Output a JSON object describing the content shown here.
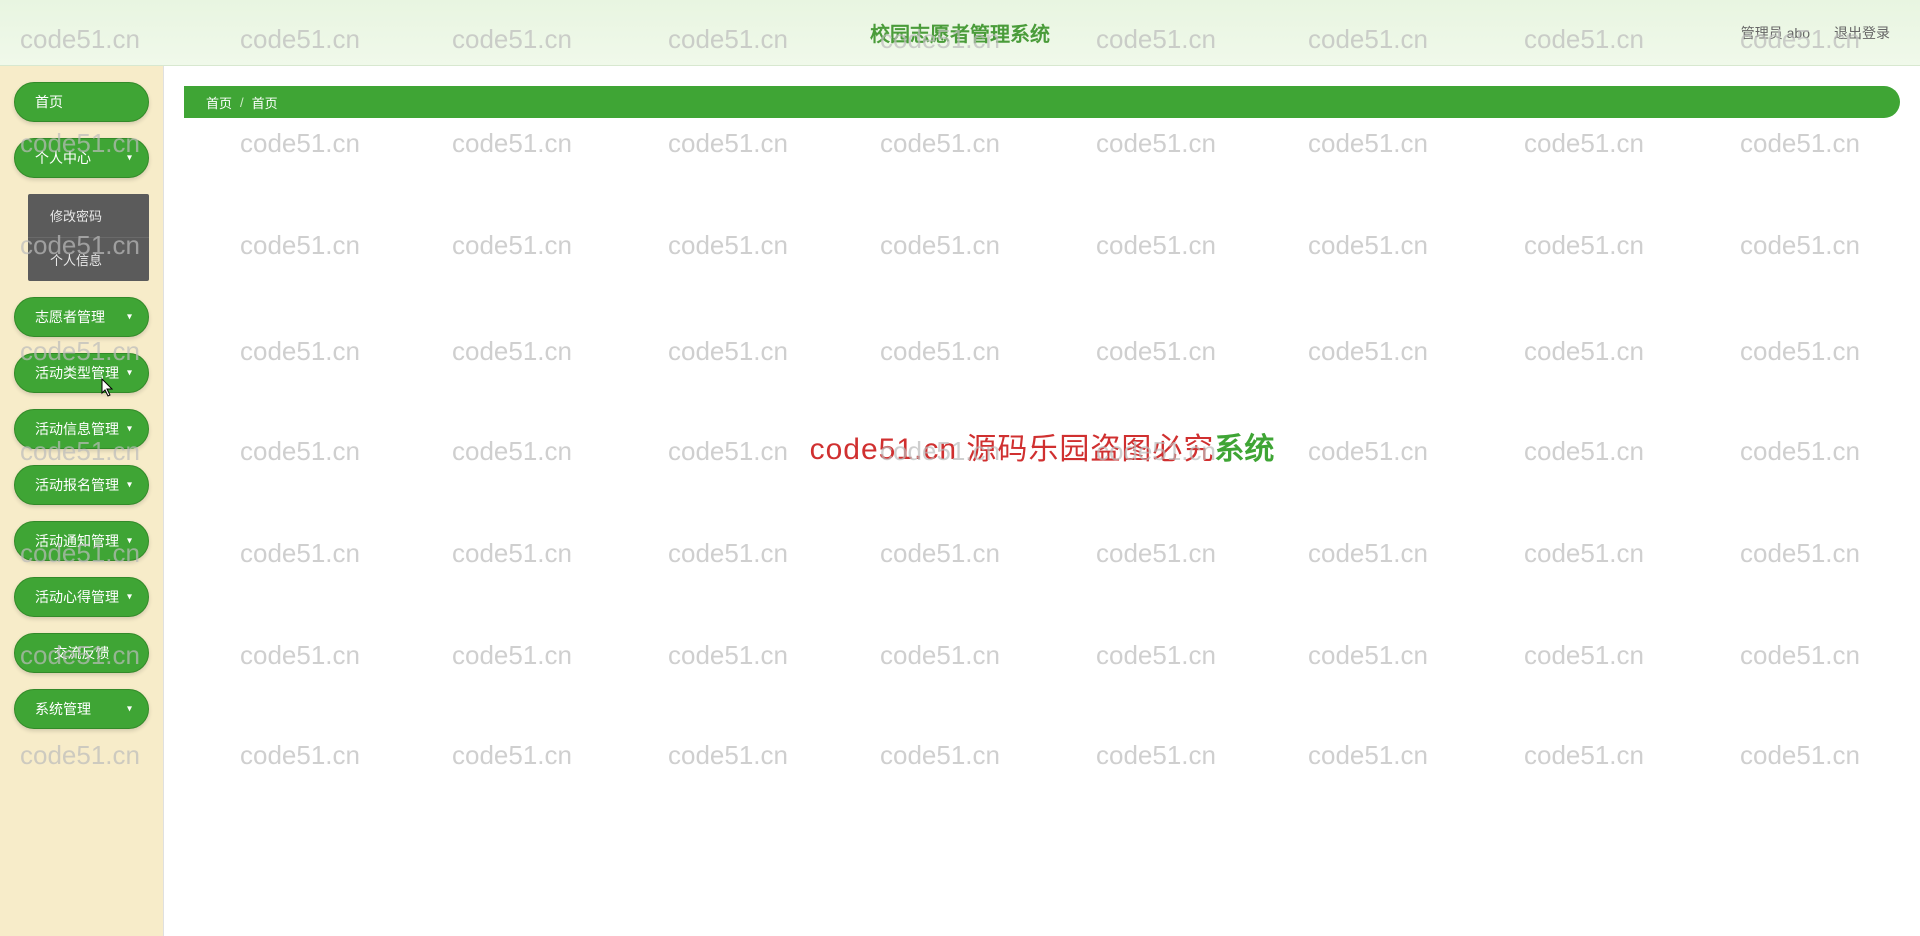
{
  "header": {
    "title": "校园志愿者管理系统",
    "user_label": "管理员 abo",
    "logout": "退出登录"
  },
  "sidebar": {
    "home": "首页",
    "personal": "个人中心",
    "personal_sub": {
      "change_pwd": "修改密码",
      "personal_info": "个人信息"
    },
    "volunteer_mgmt": "志愿者管理",
    "activity_type_mgmt": "活动类型管理",
    "activity_info_mgmt": "活动信息管理",
    "activity_reg_mgmt": "活动报名管理",
    "activity_notice_mgmt": "活动通知管理",
    "activity_exp_mgmt": "活动心得管理",
    "feedback": "交流反馈",
    "system_mgmt": "系统管理"
  },
  "breadcrumb": {
    "home": "首页",
    "current": "首页"
  },
  "welcome": {
    "red_part": "code51.cn 源码乐园盗图必究",
    "green_trail": "系统"
  },
  "watermark": "code51.cn"
}
